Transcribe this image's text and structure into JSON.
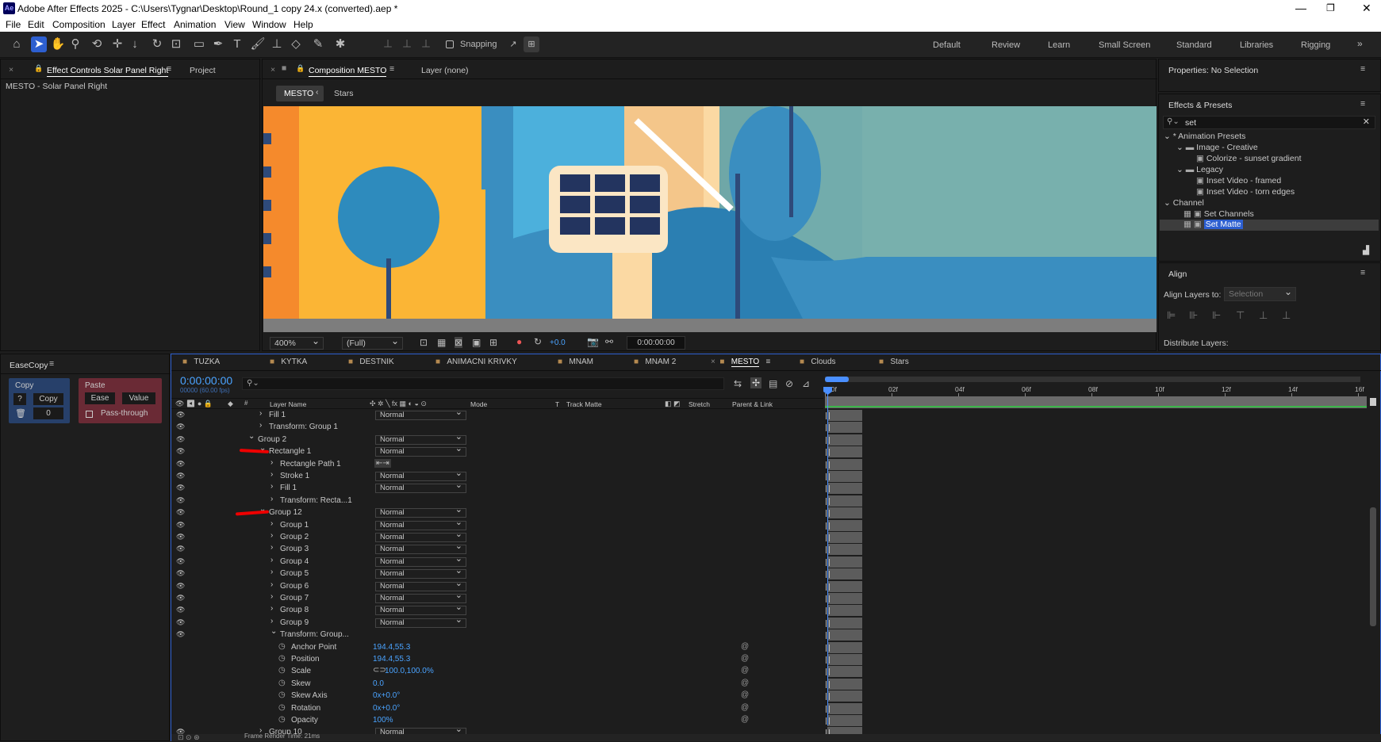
{
  "app": {
    "title": "Adobe After Effects 2025 - C:\\Users\\Tygnar\\Desktop\\Round_1 copy 24.x (converted).aep *",
    "icon_text": "Ae",
    "menu": [
      "File",
      "Edit",
      "Composition",
      "Layer",
      "Effect",
      "Animation",
      "View",
      "Window",
      "Help"
    ]
  },
  "toolbar": {
    "snapping_label": "Snapping",
    "workspaces": [
      "Default",
      "Review",
      "Learn",
      "Small Screen",
      "Standard",
      "Libraries",
      "Rigging"
    ]
  },
  "left_panel": {
    "tab_effect_controls": "Effect Controls Solar Panel Right",
    "tab_project": "Project",
    "subtitle": "MESTO - Solar Panel Right"
  },
  "comp_panel": {
    "tab_composition": "Composition MESTO",
    "tab_layer": "Layer (none)",
    "breadcrumb_active": "MESTO",
    "breadcrumb_next": "Stars",
    "zoom": "400%",
    "resolution": "(Full)",
    "exposure": "+0.0",
    "timecode": "0:00:00:00"
  },
  "right_panel": {
    "properties_title": "Properties: No Selection",
    "effects_presets_title": "Effects & Presets",
    "search_value": "set",
    "tree": [
      {
        "label": "* Animation Presets",
        "level": 0,
        "type": "group"
      },
      {
        "label": "Image - Creative",
        "level": 1,
        "type": "folder"
      },
      {
        "label": "Colorize - sunset gradient",
        "level": 2,
        "type": "preset"
      },
      {
        "label": "Legacy",
        "level": 1,
        "type": "folder"
      },
      {
        "label": "Inset Video - framed",
        "level": 2,
        "type": "preset"
      },
      {
        "label": "Inset Video - torn edges",
        "level": 2,
        "type": "preset"
      },
      {
        "label": "Channel",
        "level": 0,
        "type": "group"
      },
      {
        "label": "Set Channels",
        "level": 2,
        "type": "effect"
      },
      {
        "label": "Set Matte",
        "level": 2,
        "type": "effect",
        "selected": true
      }
    ],
    "align_title": "Align",
    "align_layers_to_label": "Align Layers to:",
    "align_layers_to_value": "Selection",
    "distribute_label": "Distribute Layers:"
  },
  "easecopy": {
    "title": "EaseCopy",
    "copy_section": "Copy",
    "help_btn": "?",
    "copy_btn": "Copy",
    "count": "0",
    "paste_section": "Paste",
    "ease_btn": "Ease",
    "value_btn": "Value",
    "passthrough_label": "Pass-through"
  },
  "timeline": {
    "tabs": [
      "TUZKA",
      "KYTKA",
      "DESTNIK",
      "ANIMACNI KRIVKY",
      "MNAM",
      "MNAM 2",
      "MESTO",
      "Clouds",
      "Stars"
    ],
    "active_tab": "MESTO",
    "timecode": "0:00:00:00",
    "fps": "00000 (60.00 fps)",
    "columns": {
      "layer_name": "Layer Name",
      "mode": "Mode",
      "t": "T",
      "track_matte": "Track Matte",
      "stretch": "Stretch",
      "parent": "Parent & Link"
    },
    "ruler": [
      "00f",
      "02f",
      "04f",
      "06f",
      "08f",
      "10f",
      "12f",
      "14f",
      "16f"
    ],
    "rows": [
      {
        "name": "Fill 1",
        "indent": 1,
        "expand": true,
        "mode": "Normal"
      },
      {
        "name": "Transform: Group 1",
        "indent": 1,
        "expand": true
      },
      {
        "name": "Group 2",
        "indent": 0,
        "expand": false,
        "mode": "Normal"
      },
      {
        "name": "Rectangle 1",
        "indent": 1,
        "expand": false,
        "mode": "Normal",
        "marked": true
      },
      {
        "name": "Rectangle Path 1",
        "indent": 2,
        "expand": true,
        "switch": "path"
      },
      {
        "name": "Stroke 1",
        "indent": 2,
        "expand": true,
        "mode": "Normal"
      },
      {
        "name": "Fill 1",
        "indent": 2,
        "expand": true,
        "mode": "Normal"
      },
      {
        "name": "Transform: Recta...1",
        "indent": 2,
        "expand": true
      },
      {
        "name": "Group 12",
        "indent": 1,
        "expand": false,
        "mode": "Normal",
        "marked": true
      },
      {
        "name": "Group 1",
        "indent": 2,
        "expand": true,
        "mode": "Normal"
      },
      {
        "name": "Group 2",
        "indent": 2,
        "expand": true,
        "mode": "Normal"
      },
      {
        "name": "Group 3",
        "indent": 2,
        "expand": true,
        "mode": "Normal"
      },
      {
        "name": "Group 4",
        "indent": 2,
        "expand": true,
        "mode": "Normal"
      },
      {
        "name": "Group 5",
        "indent": 2,
        "expand": true,
        "mode": "Normal"
      },
      {
        "name": "Group 6",
        "indent": 2,
        "expand": true,
        "mode": "Normal"
      },
      {
        "name": "Group 7",
        "indent": 2,
        "expand": true,
        "mode": "Normal"
      },
      {
        "name": "Group 8",
        "indent": 2,
        "expand": true,
        "mode": "Normal"
      },
      {
        "name": "Group 9",
        "indent": 2,
        "expand": true,
        "mode": "Normal"
      },
      {
        "name": "Transform: Group...",
        "indent": 2,
        "expand": false
      },
      {
        "name": "Anchor Point",
        "indent": 3,
        "prop": true,
        "value": "194.4,55.3"
      },
      {
        "name": "Position",
        "indent": 3,
        "prop": true,
        "value": "194.4,55.3"
      },
      {
        "name": "Scale",
        "indent": 3,
        "prop": true,
        "value": "100.0,100.0%",
        "link": true
      },
      {
        "name": "Skew",
        "indent": 3,
        "prop": true,
        "value": "0.0"
      },
      {
        "name": "Skew Axis",
        "indent": 3,
        "prop": true,
        "value": "0x+0.0°"
      },
      {
        "name": "Rotation",
        "indent": 3,
        "prop": true,
        "value": "0x+0.0°"
      },
      {
        "name": "Opacity",
        "indent": 3,
        "prop": true,
        "value": "100%"
      },
      {
        "name": "Group 10",
        "indent": 1,
        "expand": true,
        "mode": "Normal"
      }
    ],
    "frame_render_time": "Frame Render Time: 21ms"
  },
  "colors": {
    "accent": "#2d5fd0",
    "value_blue": "#4aa3ff",
    "playhead": "#4a8fff",
    "work_area": "#3cb54a"
  }
}
